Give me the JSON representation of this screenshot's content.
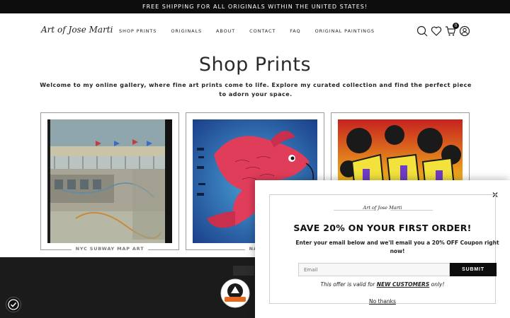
{
  "announcement": "FREE SHIPPING FOR ALL ORIGINALS WITHIN THE UNITED STATES!",
  "header": {
    "logo": "Art of Jose Marti",
    "nav": [
      "SHOP PRINTS",
      "ORIGINALS",
      "ABOUT",
      "CONTACT",
      "FAQ",
      "ORIGINAL PAINTINGS"
    ],
    "icons": [
      "search-icon",
      "heart-icon",
      "cart-icon",
      "account-icon"
    ],
    "cart_count": "0"
  },
  "main": {
    "title": "Shop Prints",
    "intro": "Welcome to my online gallery, where fine art prints come to life. Explore my curated collection and find the perfect piece to adorn your space.",
    "products": [
      {
        "caption": "NYC SUBWAY MAP ART"
      },
      {
        "caption": "NAT"
      },
      {
        "caption": ""
      }
    ]
  },
  "popup": {
    "logo": "Art of Jose Marti",
    "heading": "SAVE 20% ON YOUR FIRST ORDER!",
    "subtext": "Enter your email below and we'll email you a 20% OFF Coupon right now!",
    "email_placeholder": "Email",
    "submit_label": "SUBMIT",
    "offer_prefix": "This offer is valid for ",
    "offer_highlight": "NEW CUSTOMERS",
    "offer_suffix": " only!",
    "no_thanks": "No thanks"
  },
  "colors": {
    "topbar": "#0d0d0d",
    "footer": "#1b1b1b",
    "button": "#0d0d0d"
  }
}
